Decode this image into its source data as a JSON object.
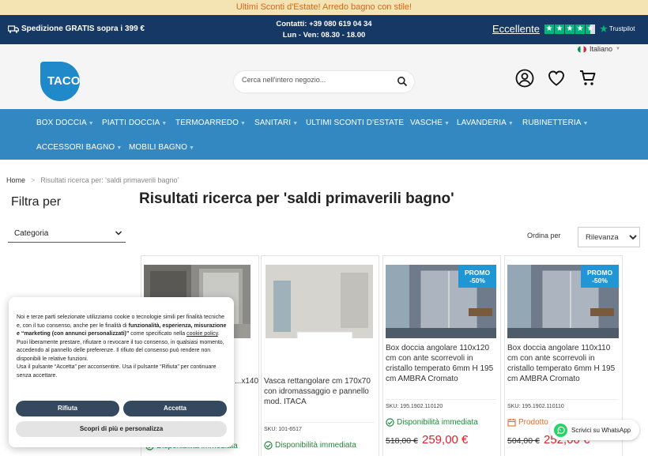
{
  "promo": {
    "text": "Ultimi Sconti d'Estate! Arredo bagno con stile!"
  },
  "topbar": {
    "shipping": "Spedizione GRATIS sopra i 399 €",
    "contacts_line1": "Contatti: +39 080 619 04 34",
    "contacts_line2": "Lun - Ven: 08.30 - 18.00",
    "rating_label": "Eccellente",
    "rating_brand": "Trustpilot",
    "rating_stars": 4.5
  },
  "header": {
    "language": "Italiano",
    "logo_text": "TACO",
    "search_placeholder": "Cerca nell'intero negozio..."
  },
  "nav": {
    "items": [
      {
        "label": "BOX DOCCIA"
      },
      {
        "label": "PIATTI DOCCIA"
      },
      {
        "label": "TERMOARREDO"
      },
      {
        "label": "SANITARI"
      },
      {
        "label": "ULTIMI SCONTI D'ESTATE"
      },
      {
        "label": "VASCHE"
      },
      {
        "label": "LAVANDERIA"
      },
      {
        "label": "RUBINETTERIA"
      },
      {
        "label": "ACCESSORI BAGNO"
      },
      {
        "label": "MOBILI BAGNO"
      }
    ]
  },
  "breadcrumb": {
    "home": "Home",
    "sep": ">",
    "current": "Risultati ricerca per: 'saldi primaverili bagno'"
  },
  "sidebar": {
    "title": "Filtra per",
    "category": "Categoria"
  },
  "results": {
    "title": "Risultati ricerca per 'saldi primaverili bagno'",
    "sort_label": "Ordina per",
    "sort_value": "Rilevanza"
  },
  "products": [
    {
      "name": "...x140",
      "sku": "",
      "availability": "Disponibilità immediata",
      "old_price": "",
      "price": ""
    },
    {
      "name": "Vasca rettangolare cm 170x70 con idromassaggio e pannello mod. ITACA",
      "sku": "SKU: 101-6517",
      "availability": "Disponibilità immediata",
      "old_price": "",
      "price": ""
    },
    {
      "name": "Box doccia angolare 110x120 cm con ante scorrevoli in cristallo temperato 6mm H 195 cm AMBRA Cromato",
      "sku": "SKU: 195.1902.110120",
      "availability": "Disponibilità immediata",
      "old_price": "518,00 €",
      "price": "259,00 €",
      "badge_line1": "PROMO",
      "badge_line2": "-50%"
    },
    {
      "name": "Box doccia angolare 110x110 cm con ante scorrevoli in cristallo temperato 6mm H 195 cm AMBRA Cromato",
      "sku": "SKU: 195.1902.110110",
      "availability": "Prodotto",
      "old_price": "504,00 €",
      "price": "252,00 €",
      "badge_line1": "PROMO",
      "badge_line2": "-50%"
    }
  ],
  "cookie": {
    "p1_a": "Noi e terze parti selezionate utilizziamo cookie o tecnologie simili per finalità tecniche e, con il tuo consenso, anche per le finalità di ",
    "p1_b": "funzionalità, esperienza, misurazione e “marketing (con annunci personalizzati)”",
    "p1_c": " come specificato nella ",
    "p1_link": "cookie policy",
    "p1_d": ".",
    "p2": "Puoi liberamente prestare, rifiutare o revocare il tuo consenso, in qualsiasi momento, accedendo al pannello delle preferenze. Il rifiuto del consenso può rendere non disponibili le relative funzioni.",
    "p3": "Usa il pulsante “Accetta” per acconsentire. Usa il pulsante “Rifiuta” per continuare senza accettare.",
    "reject": "Rifiuta",
    "accept": "Accetta",
    "customize": "Scopri di più e personalizza"
  },
  "whatsapp": {
    "label": "Scrivici su WhatsApp"
  },
  "colors": {
    "topbar": "#163865",
    "nav": "#3488c1",
    "promo_bg": "#f4e3b3",
    "price": "#d9232e",
    "available": "#1f8a3c",
    "badge": "#2096d4"
  }
}
